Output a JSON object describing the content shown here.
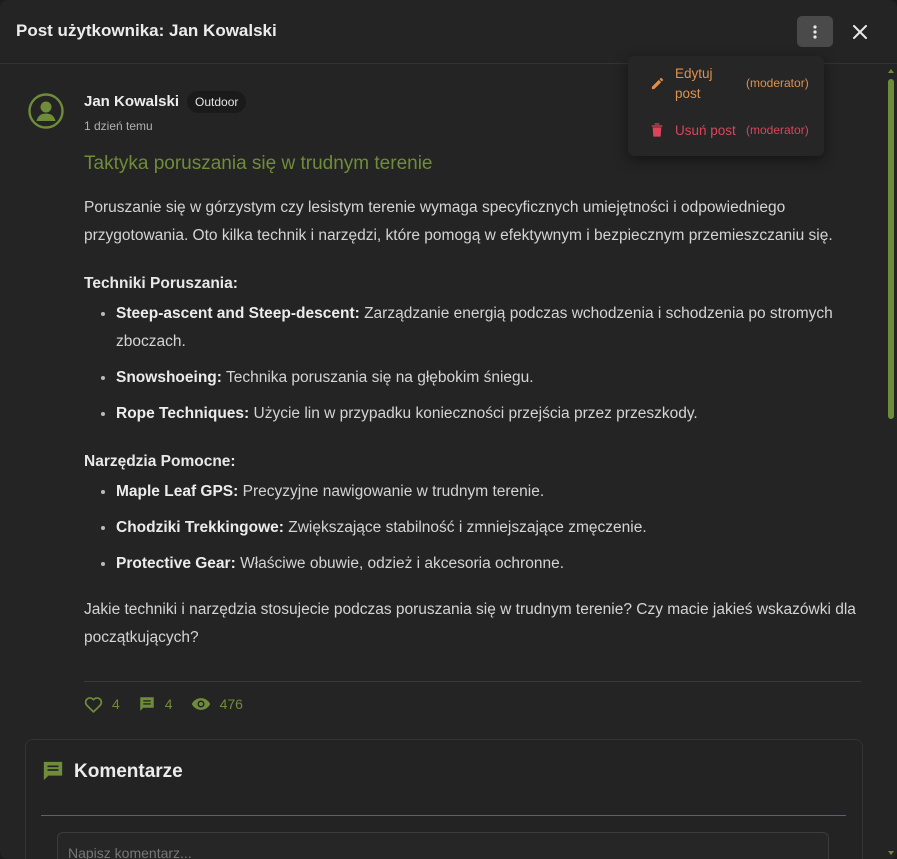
{
  "header": {
    "title": "Post użytkownika: Jan Kowalski",
    "menu_icon": "more-vertical-icon",
    "close_icon": "close-icon"
  },
  "post": {
    "author": "Jan Kowalski",
    "tag": "Outdoor",
    "time": "1 dzień temu",
    "title": "Taktyka poruszania się w trudnym terenie",
    "intro": "Poruszanie się w górzystym czy lesistym terenie wymaga specyficznych umiejętności i odpowiedniego przygotowania. Oto kilka technik i narzędzi, które pomogą w efektywnym i bezpiecznym przemieszczaniu się.",
    "sections": [
      {
        "heading": "Techniki Poruszania:",
        "items": [
          {
            "term": "Steep-ascent and Steep-descent:",
            "desc": "Zarządzanie energią podczas wchodzenia i schodzenia po stromych zboczach."
          },
          {
            "term": "Snowshoeing:",
            "desc": "Technika poruszania się na głębokim śniegu."
          },
          {
            "term": "Rope Techniques:",
            "desc": "Użycie lin w przypadku konieczności przejścia przez przeszkody."
          }
        ]
      },
      {
        "heading": "Narzędzia Pomocne:",
        "items": [
          {
            "term": "Maple Leaf GPS:",
            "desc": "Precyzyjne nawigowanie w trudnym terenie."
          },
          {
            "term": "Chodziki Trekkingowe:",
            "desc": "Zwiększające stabilność i zmniejszające zmęczenie."
          },
          {
            "term": "Protective Gear:",
            "desc": "Właściwe obuwie, odzież i akcesoria ochronne."
          }
        ]
      }
    ],
    "closing": "Jakie techniki i narzędzia stosujecie podczas poruszania się w trudnym terenie? Czy macie jakieś wskazówki dla początkujących?"
  },
  "stats": {
    "likes": "4",
    "comments": "4",
    "views": "476"
  },
  "comments": {
    "title": "Komentarze",
    "placeholder": "Napisz komentarz..."
  },
  "dropdown": {
    "edit_label": "Edytuj post",
    "edit_note": "(moderator)",
    "delete_label": "Usuń post",
    "delete_note": "(moderator)"
  },
  "colors": {
    "accent": "#6f8c3a",
    "edit": "#e0904a",
    "delete": "#d9465a",
    "background": "#242424"
  }
}
